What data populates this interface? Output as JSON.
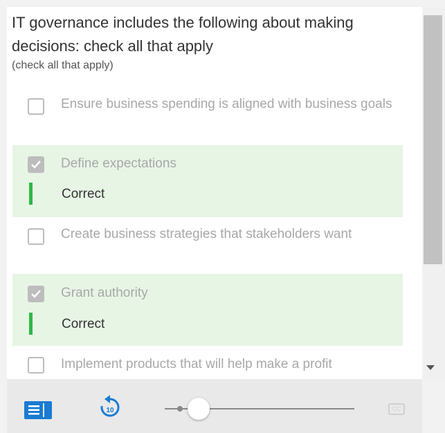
{
  "question": {
    "title": "IT governance includes the following about making decisions: check all that apply",
    "subtitle": "(check all that apply)"
  },
  "options": [
    {
      "label": "Ensure business spending is aligned with business goals",
      "checked": false,
      "feedback": ""
    },
    {
      "label": "Define expectations",
      "checked": true,
      "feedback": "Correct"
    },
    {
      "label": "Create business strategies that stakeholders want",
      "checked": false,
      "feedback": ""
    },
    {
      "label": "Grant authority",
      "checked": true,
      "feedback": "Correct"
    },
    {
      "label": "Implement products that will help make a profit",
      "checked": false,
      "feedback": ""
    }
  ],
  "controls": {
    "transcript_icon": "transcript-icon",
    "replay_icon": "replay-10-icon",
    "replay_label": "10",
    "volume_level": 0.15,
    "cc_label": "CC"
  },
  "colors": {
    "correct_bg": "#e7f5e5",
    "correct_bar": "#2fb84a",
    "accent": "#1a7bd2"
  }
}
